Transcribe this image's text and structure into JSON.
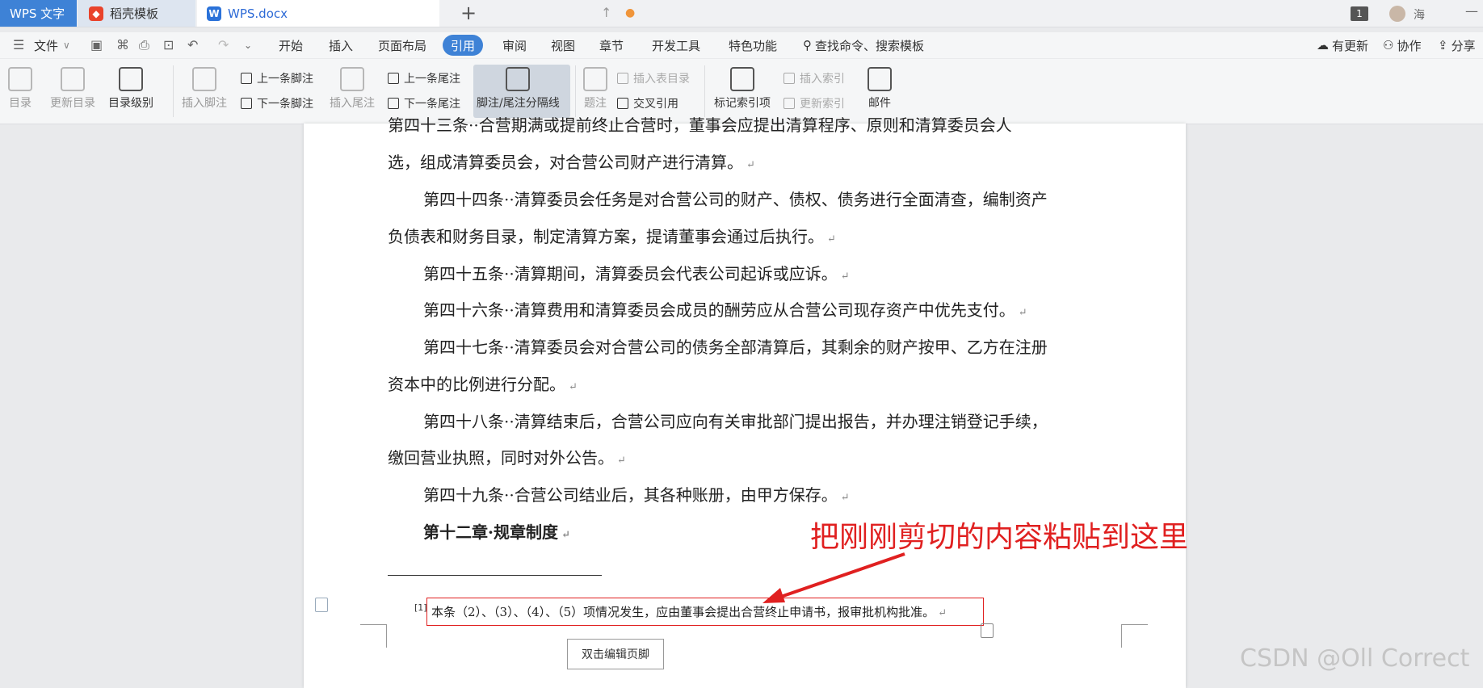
{
  "tabs": {
    "app": "WPS 文字",
    "daoke": "稻壳模板",
    "doc": "WPS.docx",
    "new_tab": "+"
  },
  "titlebar": {
    "badge": "1",
    "user": "海",
    "minimize": "—"
  },
  "menu": {
    "file": "文件",
    "items": [
      "开始",
      "插入",
      "页面布局",
      "引用",
      "审阅",
      "视图",
      "章节",
      "开发工具",
      "特色功能"
    ],
    "active": "引用",
    "search": "查找命令、搜索模板",
    "update": "有更新",
    "collab": "协作",
    "share": "分享"
  },
  "ribbon": {
    "toc": "目录",
    "update_toc": "更新目录",
    "toc_level": "目录级别",
    "insert_footnote": "插入脚注",
    "prev_footnote": "上一条脚注",
    "next_footnote": "下一条脚注",
    "insert_endnote": "插入尾注",
    "prev_endnote": "上一条尾注",
    "next_endnote": "下一条尾注",
    "separator": "脚注/尾注分隔线",
    "caption": "题注",
    "insert_table_toc": "插入表目录",
    "cross_ref": "交叉引用",
    "mark_index": "标记索引项",
    "insert_index": "插入索引",
    "update_index": "更新索引",
    "mail": "邮件"
  },
  "document": {
    "p0": "第四十三条··合营期满或提前终止合营时，董事会应提出清算程序、原则和清算委员会人",
    "p1": "选，组成清算委员会，对合营公司财产进行清算。",
    "p2a": "第四十四条··清算委员会任务是对合营公司的财产、债权、债务进行全面清查，编制资产",
    "p2b": "负债表和财务目录，制定清算方案，提请董事会通过后执行。",
    "p3": "第四十五条··清算期间，清算委员会代表公司起诉或应诉。",
    "p4": "第四十六条··清算费用和清算委员会成员的酬劳应从合营公司现存资产中优先支付。",
    "p5a": "第四十七条··清算委员会对合营公司的债务全部清算后，其剩余的财产按甲、乙方在注册",
    "p5b": "资本中的比例进行分配。",
    "p6a": "第四十八条··清算结束后，合营公司应向有关审批部门提出报告，并办理注销登记手续，",
    "p6b": "缴回营业执照，同时对外公告。",
    "p7": "第四十九条··合营公司结业后，其各种账册，由甲方保存。",
    "chapter_a": "第十二章·",
    "chapter_b": "规章制度",
    "para_mark": "↵",
    "footnote_ref": "[1]",
    "footnote": "本条（2）、（3）、（4）、（5）项情况发生，应由董事会提出合营终止申请书，报审批机构批准。",
    "footer_button": "双击编辑页脚"
  },
  "annotation": "把刚刚剪切的内容粘贴到这里",
  "watermark": "CSDN @Oll Correct",
  "colors": {
    "accent": "#3e82d6",
    "annotation_red": "#e02020"
  }
}
